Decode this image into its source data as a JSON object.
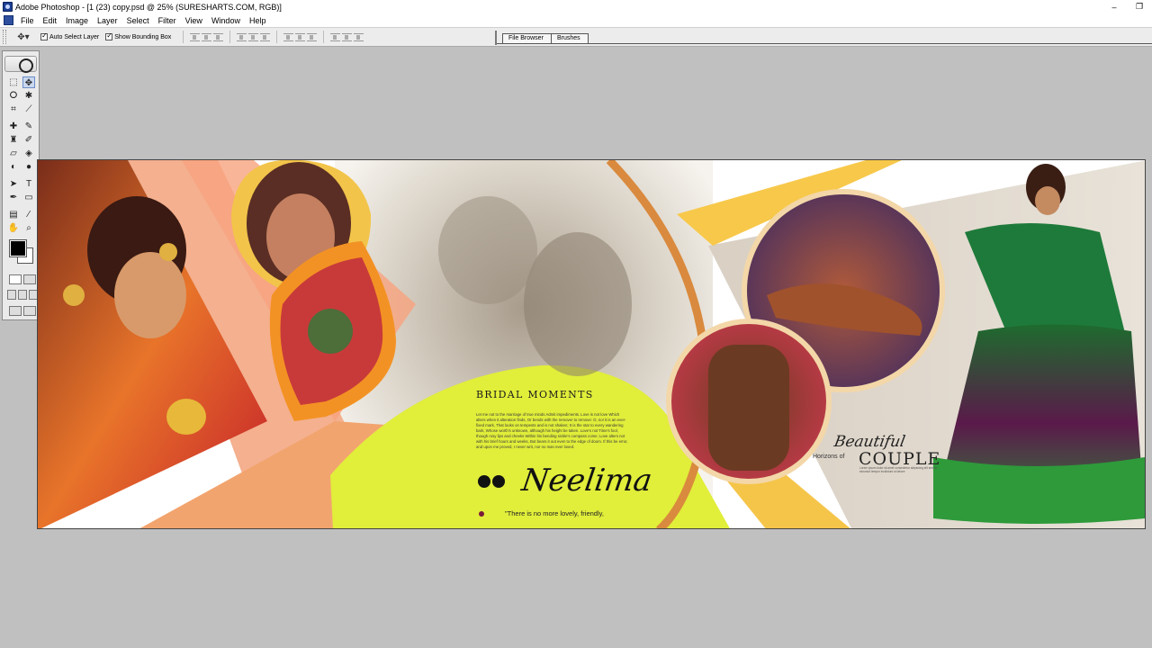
{
  "window": {
    "title": "Adobe Photoshop - [1 (23) copy.psd @ 25% (SURESHARTS.COM, RGB)]",
    "minimize_glyph": "–",
    "restore_glyph": "❐"
  },
  "menu": {
    "items": [
      "File",
      "Edit",
      "Image",
      "Layer",
      "Select",
      "Filter",
      "View",
      "Window",
      "Help"
    ]
  },
  "options": {
    "tool_preset_icon": "move-tool-icon",
    "auto_select_layer": {
      "label": "Auto Select Layer",
      "checked": true
    },
    "show_bounding_box": {
      "label": "Show Bounding Box",
      "checked": true
    }
  },
  "palette_well": {
    "tabs": [
      "File Browser",
      "Brushes"
    ]
  },
  "toolbox": {
    "tools": [
      "marquee-icon",
      "move-icon",
      "lasso-icon",
      "magic-wand-icon",
      "crop-icon",
      "slice-icon",
      "healing-brush-icon",
      "brush-icon",
      "clone-stamp-icon",
      "history-brush-icon",
      "eraser-icon",
      "paint-bucket-icon",
      "blur-icon",
      "dodge-icon",
      "path-selection-icon",
      "type-icon",
      "pen-icon",
      "shape-icon",
      "notes-icon",
      "eyedropper-icon",
      "hand-icon",
      "zoom-icon"
    ],
    "foreground_color": "#000000",
    "background_color": "#ffffff"
  },
  "document": {
    "heading": "BRIDAL MOMENTS",
    "body": "Let me not to the marriage of true minds Admit impediments. Love is not love Which alters when it alteration finds, Or bends with the remover to remove: O, no! it is an ever-fixed mark, That looks on tempests and is not shaken; It is the star to every wandering bark, Whose worth's unknown, although his height be taken. Love's not Time's fool, though rosy lips and cheeks Within his bending sickle's compass come; Love alters not with his brief hours and weeks, But bears it out even to the edge of doom. If this be error, and upon me proved, I never writ, nor no man ever loved.",
    "name": "Neelima",
    "quote": "\"There is no more lovely, friendly,",
    "beautiful": "Beautiful",
    "horizons": "Horizons of",
    "couple": "COUPLE",
    "couple_sub": "Lorem ipsum dolor sit amet consectetur adipiscing elit sed do eiusmod tempor incididunt ut labore",
    "colors": {
      "peach": "#f7a37e",
      "orange": "#f08a2c",
      "gold": "#f7c84a",
      "lime": "#e1ee3a",
      "salmon": "#f4b08f"
    }
  }
}
